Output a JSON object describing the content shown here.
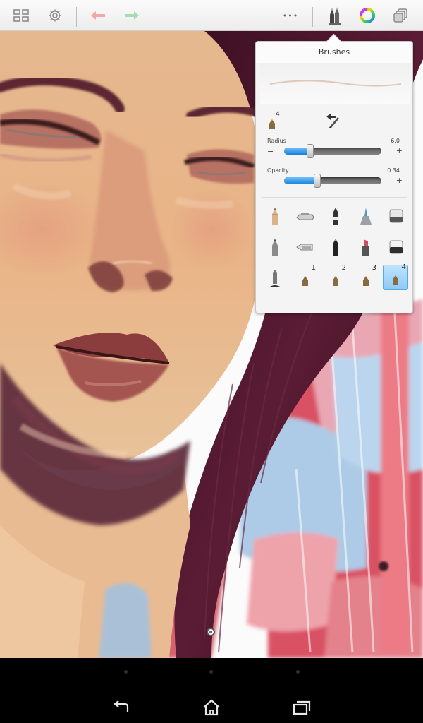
{
  "toolbar": {
    "icons": [
      "gallery-grid-icon",
      "settings-gear-icon",
      "undo-arrow-icon",
      "redo-arrow-icon",
      "more-dots-icon",
      "brushes-icon",
      "color-wheel-icon",
      "layers-icon"
    ],
    "more_label": "•••"
  },
  "brushes_panel": {
    "title": "Brushes",
    "current_brush_size_badge": "4",
    "radius": {
      "label": "Radius",
      "value": "6.0",
      "level": 0.27,
      "minus": "−",
      "plus": "+"
    },
    "opacity": {
      "label": "Opacity",
      "value": "0.34",
      "level": 0.34,
      "minus": "−",
      "plus": "+"
    },
    "brush_rows": [
      [
        "pencil",
        "ballpoint-pen",
        "marker",
        "airbrush",
        "eraser-soft"
      ],
      [
        "fine-pencil",
        "chisel-marker",
        "felt-pen",
        "highlighter",
        "eraser-hard"
      ],
      [
        "smudge-tool",
        "preset-1",
        "preset-2",
        "preset-3",
        "preset-4"
      ]
    ],
    "preset_numbers": [
      "1",
      "2",
      "3",
      "4"
    ],
    "selected_preset": "4"
  },
  "navigation_bar": {
    "buttons": [
      "back-icon",
      "home-icon",
      "recent-apps-icon"
    ]
  },
  "colors": {
    "accent_blue": "#2a8ee0",
    "selection_blue": "#8ccaf6",
    "hair": "#4a1628",
    "skin": "#e8b488"
  }
}
